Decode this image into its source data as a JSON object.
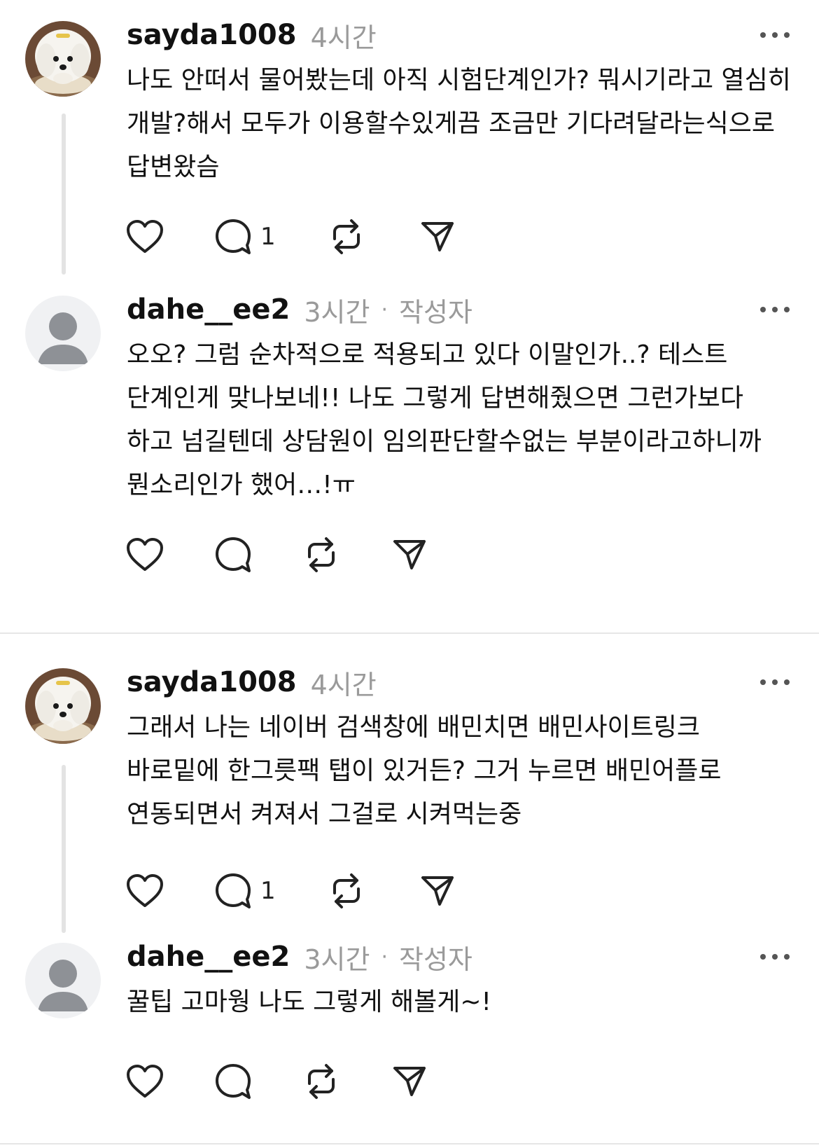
{
  "threads": [
    {
      "parent": {
        "username": "sayda1008",
        "time": "4시간",
        "text": "나도 안떠서 물어봤는데 아직 시험단계인가? 뭐시기라고 열심히 개발?해서 모두가 이용할수있게끔 조금만 기다려달라는식으로 답변왔슴",
        "reply_count": "1",
        "avatar": "white-puppy-avatar"
      },
      "reply": {
        "username": "dahe__ee2",
        "time": "3시간",
        "separator": "·",
        "author_tag": "작성자",
        "text": "오오? 그럼 순차적으로 적용되고 있다 이말인가..? 테스트 단계인게 맞나보네!! 나도 그렇게 답변해줬으면 그런가보다 하고 넘길텐데 상담원이 임의판단할수없는 부분이라고하니까 뭔소리인가 했어…!ㅠ",
        "avatar": "default-person-avatar"
      }
    },
    {
      "parent": {
        "username": "sayda1008",
        "time": "4시간",
        "text": "그래서 나는 네이버 검색창에 배민치면 배민사이트링크 바로밑에 한그릇팩 탭이 있거든? 그거 누르면 배민어플로 연동되면서 켜져서 그걸로 시켜먹는중",
        "reply_count": "1",
        "avatar": "white-puppy-avatar"
      },
      "reply": {
        "username": "dahe__ee2",
        "time": "3시간",
        "separator": "·",
        "author_tag": "작성자",
        "text": "꿀팁 고마웡 나도 그렇게 해볼게~!",
        "avatar": "default-person-avatar"
      }
    }
  ],
  "icons": {
    "like": "heart-icon",
    "comment": "comment-bubble-icon",
    "repost": "repost-arrows-icon",
    "share": "paper-plane-icon",
    "more": "more-dots-icon"
  },
  "colors": {
    "text": "#111111",
    "meta": "#9a9a9a",
    "thread_line": "#e3e3e3",
    "divider": "#e6e6e6"
  }
}
